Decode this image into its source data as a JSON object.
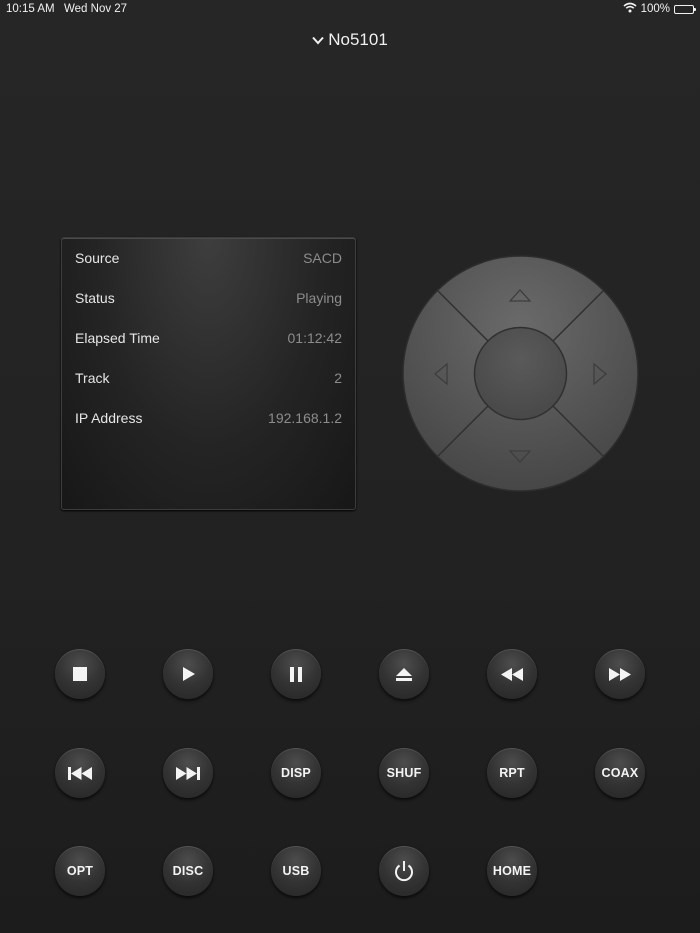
{
  "status_bar": {
    "time": "10:15 AM",
    "date": "Wed Nov 27",
    "battery": "100%"
  },
  "header": {
    "device_name": "No5101"
  },
  "info_panel": {
    "rows": [
      {
        "label": "Source",
        "value": "SACD"
      },
      {
        "label": "Status",
        "value": "Playing"
      },
      {
        "label": "Elapsed Time",
        "value": "01:12:42"
      },
      {
        "label": "Track",
        "value": "2"
      },
      {
        "label": "IP Address",
        "value": "192.168.1.2"
      }
    ]
  },
  "controls": {
    "disp": "DISP",
    "shuf": "SHUF",
    "rpt": "RPT",
    "coax": "COAX",
    "opt": "OPT",
    "disc": "DISC",
    "usb": "USB",
    "home": "HOME"
  }
}
